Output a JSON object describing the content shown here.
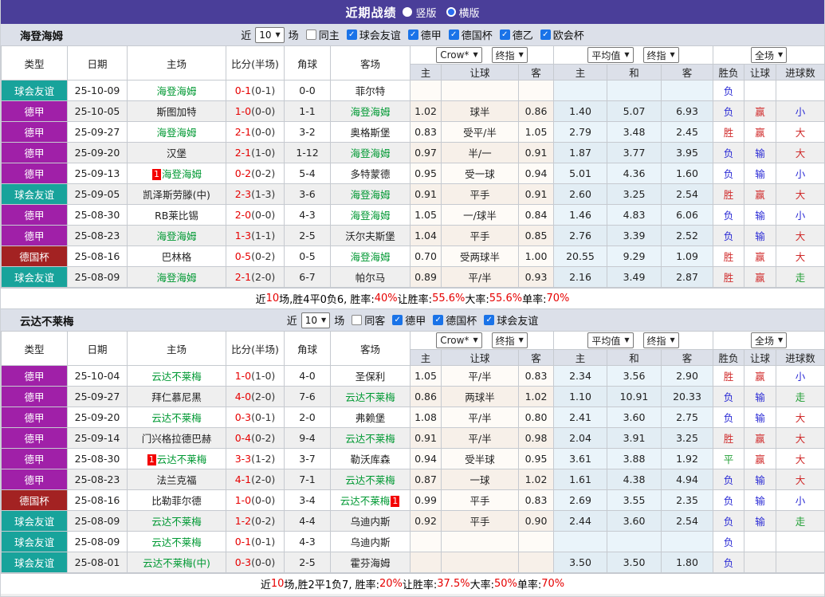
{
  "title_bar": {
    "title": "近期战绩",
    "radio_vertical": "竖版",
    "radio_horizontal": "横版"
  },
  "icons": {
    "dropdown_arrow": "▼",
    "check": "✓",
    "radio_selected": "radio-selected-icon",
    "radio_unselected": "radio-unselected-icon"
  },
  "colors": {
    "titlebar_bg": "#4a3e99",
    "header_bg": "#dce0e9",
    "type_friendly": "#18a39b",
    "type_league": "#a020a8",
    "type_cup": "#a32222",
    "team_green": "#009933",
    "score_red": "#e60000",
    "win_red": "#d02c2c",
    "lose_blue": "#2b2bd5",
    "draw_green": "#1f9e33",
    "checkbox_blue": "#1a73e8",
    "crow_col_bg": "#f7f0e9",
    "avg_col_bg": "#eaf4fa"
  },
  "table_header": {
    "col_type": "类型",
    "col_date": "日期",
    "col_home": "主场",
    "col_score": "比分(半场)",
    "col_corner": "角球",
    "col_away": "客场",
    "dd_crow": "Crow*",
    "dd_final1": "终指",
    "dd_avg": "平均值",
    "dd_final2": "终指",
    "dd_full": "全场",
    "sub_home": "主",
    "sub_handicap": "让球",
    "sub_away": "客",
    "sub_avg_home": "主",
    "sub_avg_draw": "和",
    "sub_avg_away": "客",
    "col_result": "胜负",
    "col_handicap_result": "让球",
    "col_goals": "进球数"
  },
  "sections": [
    {
      "team": "海登海姆",
      "filter": {
        "near_label": "近",
        "count": "10",
        "games_label": "场",
        "same_label": "同主",
        "leagues": [
          "球会友谊",
          "德甲",
          "德国杯",
          "德乙",
          "欧会杯"
        ]
      },
      "rows": [
        {
          "type": "球会友谊",
          "type_key": "friendly",
          "date": "25-10-09",
          "home": {
            "name": "海登海姆",
            "green": true
          },
          "score": "0-1",
          "half": "(0-1)",
          "corner": "0-0",
          "away": {
            "name": "菲尔特",
            "green": false
          },
          "crow": [
            "",
            "",
            ""
          ],
          "avg": [
            "",
            "",
            ""
          ],
          "outcome": {
            "text": "负",
            "color": "blue"
          },
          "handicap": {
            "text": "",
            "color": ""
          },
          "goals": {
            "text": "",
            "color": ""
          }
        },
        {
          "type": "德甲",
          "type_key": "league",
          "date": "25-10-05",
          "home": {
            "name": "斯图加特",
            "green": false
          },
          "score": "1-0",
          "half": "(0-0)",
          "corner": "1-1",
          "away": {
            "name": "海登海姆",
            "green": true
          },
          "crow": [
            "1.02",
            "球半",
            "0.86"
          ],
          "avg": [
            "1.40",
            "5.07",
            "6.93"
          ],
          "outcome": {
            "text": "负",
            "color": "blue"
          },
          "handicap": {
            "text": "赢",
            "color": "red"
          },
          "goals": {
            "text": "小",
            "color": "blue"
          }
        },
        {
          "type": "德甲",
          "type_key": "league",
          "date": "25-09-27",
          "home": {
            "name": "海登海姆",
            "green": true
          },
          "score": "2-1",
          "half": "(0-0)",
          "corner": "3-2",
          "away": {
            "name": "奥格斯堡",
            "green": false
          },
          "crow": [
            "0.83",
            "受平/半",
            "1.05"
          ],
          "avg": [
            "2.79",
            "3.48",
            "2.45"
          ],
          "outcome": {
            "text": "胜",
            "color": "red"
          },
          "handicap": {
            "text": "赢",
            "color": "red"
          },
          "goals": {
            "text": "大",
            "color": "red"
          }
        },
        {
          "type": "德甲",
          "type_key": "league",
          "date": "25-09-20",
          "home": {
            "name": "汉堡",
            "green": false
          },
          "score": "2-1",
          "half": "(1-0)",
          "corner": "1-12",
          "away": {
            "name": "海登海姆",
            "green": true
          },
          "crow": [
            "0.97",
            "半/一",
            "0.91"
          ],
          "avg": [
            "1.87",
            "3.77",
            "3.95"
          ],
          "outcome": {
            "text": "负",
            "color": "blue"
          },
          "handicap": {
            "text": "输",
            "color": "blue"
          },
          "goals": {
            "text": "大",
            "color": "red"
          }
        },
        {
          "type": "德甲",
          "type_key": "league",
          "date": "25-09-13",
          "home": {
            "name": "海登海姆",
            "green": true,
            "mark": "1",
            "mark_pos": "before"
          },
          "score": "0-2",
          "half": "(0-2)",
          "corner": "5-4",
          "away": {
            "name": "多特蒙德",
            "green": false
          },
          "crow": [
            "0.95",
            "受一球",
            "0.94"
          ],
          "avg": [
            "5.01",
            "4.36",
            "1.60"
          ],
          "outcome": {
            "text": "负",
            "color": "blue"
          },
          "handicap": {
            "text": "输",
            "color": "blue"
          },
          "goals": {
            "text": "小",
            "color": "blue"
          }
        },
        {
          "type": "球会友谊",
          "type_key": "friendly",
          "date": "25-09-05",
          "home": {
            "name": "凯泽斯劳滕(中)",
            "green": false
          },
          "score": "2-3",
          "half": "(1-3)",
          "corner": "3-6",
          "away": {
            "name": "海登海姆",
            "green": true
          },
          "crow": [
            "0.91",
            "平手",
            "0.91"
          ],
          "avg": [
            "2.60",
            "3.25",
            "2.54"
          ],
          "outcome": {
            "text": "胜",
            "color": "red"
          },
          "handicap": {
            "text": "赢",
            "color": "red"
          },
          "goals": {
            "text": "大",
            "color": "red"
          }
        },
        {
          "type": "德甲",
          "type_key": "league",
          "date": "25-08-30",
          "home": {
            "name": "RB莱比锡",
            "green": false
          },
          "score": "2-0",
          "half": "(0-0)",
          "corner": "4-3",
          "away": {
            "name": "海登海姆",
            "green": true
          },
          "crow": [
            "1.05",
            "一/球半",
            "0.84"
          ],
          "avg": [
            "1.46",
            "4.83",
            "6.06"
          ],
          "outcome": {
            "text": "负",
            "color": "blue"
          },
          "handicap": {
            "text": "输",
            "color": "blue"
          },
          "goals": {
            "text": "小",
            "color": "blue"
          }
        },
        {
          "type": "德甲",
          "type_key": "league",
          "date": "25-08-23",
          "home": {
            "name": "海登海姆",
            "green": true
          },
          "score": "1-3",
          "half": "(1-1)",
          "corner": "2-5",
          "away": {
            "name": "沃尔夫斯堡",
            "green": false
          },
          "crow": [
            "1.04",
            "平手",
            "0.85"
          ],
          "avg": [
            "2.76",
            "3.39",
            "2.52"
          ],
          "outcome": {
            "text": "负",
            "color": "blue"
          },
          "handicap": {
            "text": "输",
            "color": "blue"
          },
          "goals": {
            "text": "大",
            "color": "red"
          }
        },
        {
          "type": "德国杯",
          "type_key": "cup",
          "date": "25-08-16",
          "home": {
            "name": "巴林格",
            "green": false
          },
          "score": "0-5",
          "half": "(0-2)",
          "corner": "0-5",
          "away": {
            "name": "海登海姆",
            "green": true
          },
          "crow": [
            "0.70",
            "受两球半",
            "1.00"
          ],
          "avg": [
            "20.55",
            "9.29",
            "1.09"
          ],
          "outcome": {
            "text": "胜",
            "color": "red"
          },
          "handicap": {
            "text": "赢",
            "color": "red"
          },
          "goals": {
            "text": "大",
            "color": "red"
          }
        },
        {
          "type": "球会友谊",
          "type_key": "friendly",
          "date": "25-08-09",
          "home": {
            "name": "海登海姆",
            "green": true
          },
          "score": "2-1",
          "half": "(2-0)",
          "corner": "6-7",
          "away": {
            "name": "帕尔马",
            "green": false
          },
          "crow": [
            "0.89",
            "平/半",
            "0.93"
          ],
          "avg": [
            "2.16",
            "3.49",
            "2.87"
          ],
          "outcome": {
            "text": "胜",
            "color": "red"
          },
          "handicap": {
            "text": "赢",
            "color": "red"
          },
          "goals": {
            "text": "走",
            "color": "green"
          }
        }
      ],
      "summary": [
        {
          "text": "近",
          "red": false
        },
        {
          "text": "10",
          "red": true
        },
        {
          "text": "场,胜4平0负6, 胜率:",
          "red": false
        },
        {
          "text": "40%",
          "red": true
        },
        {
          "text": " 让胜率:",
          "red": false
        },
        {
          "text": "55.6%",
          "red": true
        },
        {
          "text": " 大率:",
          "red": false
        },
        {
          "text": "55.6%",
          "red": true
        },
        {
          "text": " 单率:",
          "red": false
        },
        {
          "text": "70%",
          "red": true
        }
      ]
    },
    {
      "team": "云达不莱梅",
      "filter": {
        "near_label": "近",
        "count": "10",
        "games_label": "场",
        "same_label": "同客",
        "leagues": [
          "德甲",
          "德国杯",
          "球会友谊"
        ]
      },
      "rows": [
        {
          "type": "德甲",
          "type_key": "league",
          "date": "25-10-04",
          "home": {
            "name": "云达不莱梅",
            "green": true
          },
          "score": "1-0",
          "half": "(1-0)",
          "corner": "4-0",
          "away": {
            "name": "圣保利",
            "green": false
          },
          "crow": [
            "1.05",
            "平/半",
            "0.83"
          ],
          "avg": [
            "2.34",
            "3.56",
            "2.90"
          ],
          "outcome": {
            "text": "胜",
            "color": "red"
          },
          "handicap": {
            "text": "赢",
            "color": "red"
          },
          "goals": {
            "text": "小",
            "color": "blue"
          }
        },
        {
          "type": "德甲",
          "type_key": "league",
          "date": "25-09-27",
          "home": {
            "name": "拜仁慕尼黑",
            "green": false
          },
          "score": "4-0",
          "half": "(2-0)",
          "corner": "7-6",
          "away": {
            "name": "云达不莱梅",
            "green": true
          },
          "crow": [
            "0.86",
            "两球半",
            "1.02"
          ],
          "avg": [
            "1.10",
            "10.91",
            "20.33"
          ],
          "outcome": {
            "text": "负",
            "color": "blue"
          },
          "handicap": {
            "text": "输",
            "color": "blue"
          },
          "goals": {
            "text": "走",
            "color": "green"
          }
        },
        {
          "type": "德甲",
          "type_key": "league",
          "date": "25-09-20",
          "home": {
            "name": "云达不莱梅",
            "green": true
          },
          "score": "0-3",
          "half": "(0-1)",
          "corner": "2-0",
          "away": {
            "name": "弗赖堡",
            "green": false
          },
          "crow": [
            "1.08",
            "平/半",
            "0.80"
          ],
          "avg": [
            "2.41",
            "3.60",
            "2.75"
          ],
          "outcome": {
            "text": "负",
            "color": "blue"
          },
          "handicap": {
            "text": "输",
            "color": "blue"
          },
          "goals": {
            "text": "大",
            "color": "red"
          }
        },
        {
          "type": "德甲",
          "type_key": "league",
          "date": "25-09-14",
          "home": {
            "name": "门兴格拉德巴赫",
            "green": false
          },
          "score": "0-4",
          "half": "(0-2)",
          "corner": "9-4",
          "away": {
            "name": "云达不莱梅",
            "green": true
          },
          "crow": [
            "0.91",
            "平/半",
            "0.98"
          ],
          "avg": [
            "2.04",
            "3.91",
            "3.25"
          ],
          "outcome": {
            "text": "胜",
            "color": "red"
          },
          "handicap": {
            "text": "赢",
            "color": "red"
          },
          "goals": {
            "text": "大",
            "color": "red"
          }
        },
        {
          "type": "德甲",
          "type_key": "league",
          "date": "25-08-30",
          "home": {
            "name": "云达不莱梅",
            "green": true,
            "mark": "1",
            "mark_pos": "before"
          },
          "score": "3-3",
          "half": "(1-2)",
          "corner": "3-7",
          "away": {
            "name": "勒沃库森",
            "green": false
          },
          "crow": [
            "0.94",
            "受半球",
            "0.95"
          ],
          "avg": [
            "3.61",
            "3.88",
            "1.92"
          ],
          "outcome": {
            "text": "平",
            "color": "green"
          },
          "handicap": {
            "text": "赢",
            "color": "red"
          },
          "goals": {
            "text": "大",
            "color": "red"
          }
        },
        {
          "type": "德甲",
          "type_key": "league",
          "date": "25-08-23",
          "home": {
            "name": "法兰克福",
            "green": false
          },
          "score": "4-1",
          "half": "(2-0)",
          "corner": "7-1",
          "away": {
            "name": "云达不莱梅",
            "green": true
          },
          "crow": [
            "0.87",
            "一球",
            "1.02"
          ],
          "avg": [
            "1.61",
            "4.38",
            "4.94"
          ],
          "outcome": {
            "text": "负",
            "color": "blue"
          },
          "handicap": {
            "text": "输",
            "color": "blue"
          },
          "goals": {
            "text": "大",
            "color": "red"
          }
        },
        {
          "type": "德国杯",
          "type_key": "cup",
          "date": "25-08-16",
          "home": {
            "name": "比勒菲尔德",
            "green": false
          },
          "score": "1-0",
          "half": "(0-0)",
          "corner": "3-4",
          "away": {
            "name": "云达不莱梅",
            "green": true,
            "mark": "1",
            "mark_pos": "after"
          },
          "crow": [
            "0.99",
            "平手",
            "0.83"
          ],
          "avg": [
            "2.69",
            "3.55",
            "2.35"
          ],
          "outcome": {
            "text": "负",
            "color": "blue"
          },
          "handicap": {
            "text": "输",
            "color": "blue"
          },
          "goals": {
            "text": "小",
            "color": "blue"
          }
        },
        {
          "type": "球会友谊",
          "type_key": "friendly",
          "date": "25-08-09",
          "home": {
            "name": "云达不莱梅",
            "green": true
          },
          "score": "1-2",
          "half": "(0-2)",
          "corner": "4-4",
          "away": {
            "name": "乌迪内斯",
            "green": false
          },
          "crow": [
            "0.92",
            "平手",
            "0.90"
          ],
          "avg": [
            "2.44",
            "3.60",
            "2.54"
          ],
          "outcome": {
            "text": "负",
            "color": "blue"
          },
          "handicap": {
            "text": "输",
            "color": "blue"
          },
          "goals": {
            "text": "走",
            "color": "green"
          }
        },
        {
          "type": "球会友谊",
          "type_key": "friendly",
          "date": "25-08-09",
          "home": {
            "name": "云达不莱梅",
            "green": true
          },
          "score": "0-1",
          "half": "(0-1)",
          "corner": "4-3",
          "away": {
            "name": "乌迪内斯",
            "green": false
          },
          "crow": [
            "",
            "",
            ""
          ],
          "avg": [
            "",
            "",
            ""
          ],
          "outcome": {
            "text": "负",
            "color": "blue"
          },
          "handicap": {
            "text": "",
            "color": ""
          },
          "goals": {
            "text": "",
            "color": ""
          }
        },
        {
          "type": "球会友谊",
          "type_key": "friendly",
          "date": "25-08-01",
          "home": {
            "name": "云达不莱梅(中)",
            "green": true
          },
          "score": "0-3",
          "half": "(0-0)",
          "corner": "2-5",
          "away": {
            "name": "霍芬海姆",
            "green": false
          },
          "crow": [
            "",
            "",
            ""
          ],
          "avg": [
            "3.50",
            "3.50",
            "1.80"
          ],
          "outcome": {
            "text": "负",
            "color": "blue"
          },
          "handicap": {
            "text": "",
            "color": ""
          },
          "goals": {
            "text": "",
            "color": ""
          }
        }
      ],
      "summary": [
        {
          "text": "近",
          "red": false
        },
        {
          "text": "10",
          "red": true
        },
        {
          "text": "场,胜2平1负7, 胜率:",
          "red": false
        },
        {
          "text": "20%",
          "red": true
        },
        {
          "text": " 让胜率:",
          "red": false
        },
        {
          "text": "37.5%",
          "red": true
        },
        {
          "text": " 大率:",
          "red": false
        },
        {
          "text": "50%",
          "red": true
        },
        {
          "text": " 单率:",
          "red": false
        },
        {
          "text": "70%",
          "red": true
        }
      ]
    }
  ]
}
